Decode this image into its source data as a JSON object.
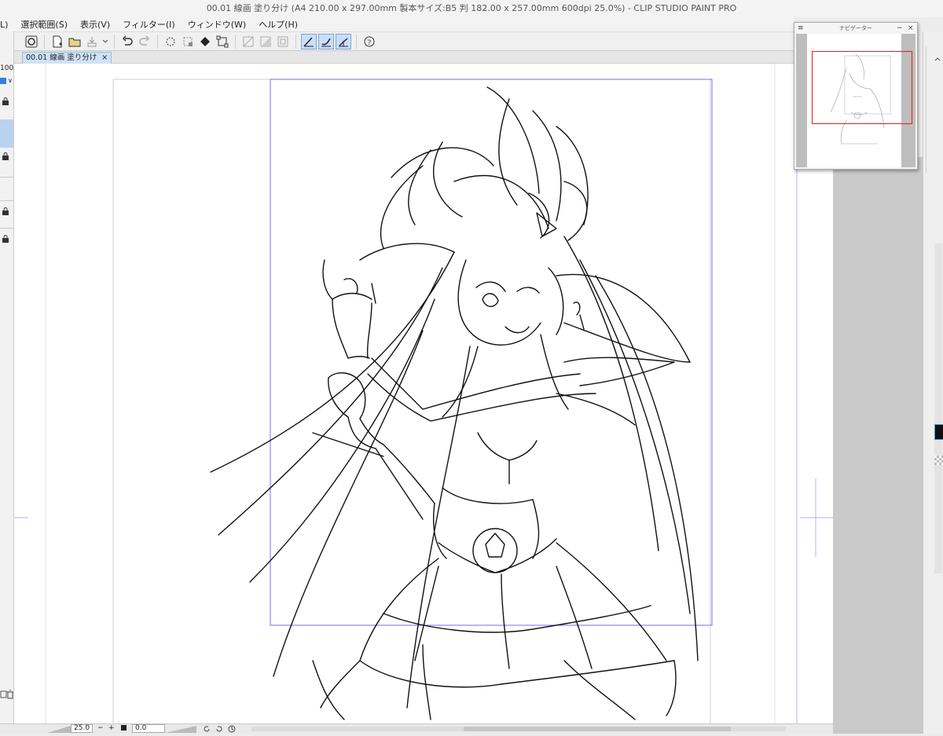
{
  "app": {
    "title": "00.01 線画 塗り分け (A4 210.00 x 297.00mm 製本サイズ:B5 判 182.00 x 257.00mm 600dpi 25.0%)  - CLIP STUDIO PAINT PRO"
  },
  "menu": {
    "items": [
      "L)",
      "選択範囲(S)",
      "表示(V)",
      "フィルター(I)",
      "ウィンドウ(W)",
      "ヘルプ(H)"
    ]
  },
  "toolbar": {
    "icons": [
      "clip-studio-icon",
      "new-file-icon",
      "open-file-icon",
      "save-icon",
      "undo-icon",
      "redo-icon",
      "clear-icon",
      "fill-icon",
      "transform-icon",
      "crop-icon",
      "snap-ruler-icon",
      "snap-grid-icon",
      "snap-special-icon",
      "help-icon"
    ]
  },
  "tabs": [
    {
      "label": "00.01 線画 塗り分け",
      "close": "×"
    }
  ],
  "left_panel": {
    "opacity": "100",
    "spinner": "◇",
    "dropdown": "∨"
  },
  "status": {
    "zoom": "25.0",
    "minus": "−",
    "plus": "+",
    "angle": "0.0"
  },
  "navigator": {
    "title": "ナビゲーター",
    "minimize": "−",
    "close": "×",
    "menu": "≡"
  },
  "colors": {
    "accent_blue": "#c9dff5",
    "navigator_frame": "#e02020",
    "ruler_purple": "#7b68ee"
  }
}
